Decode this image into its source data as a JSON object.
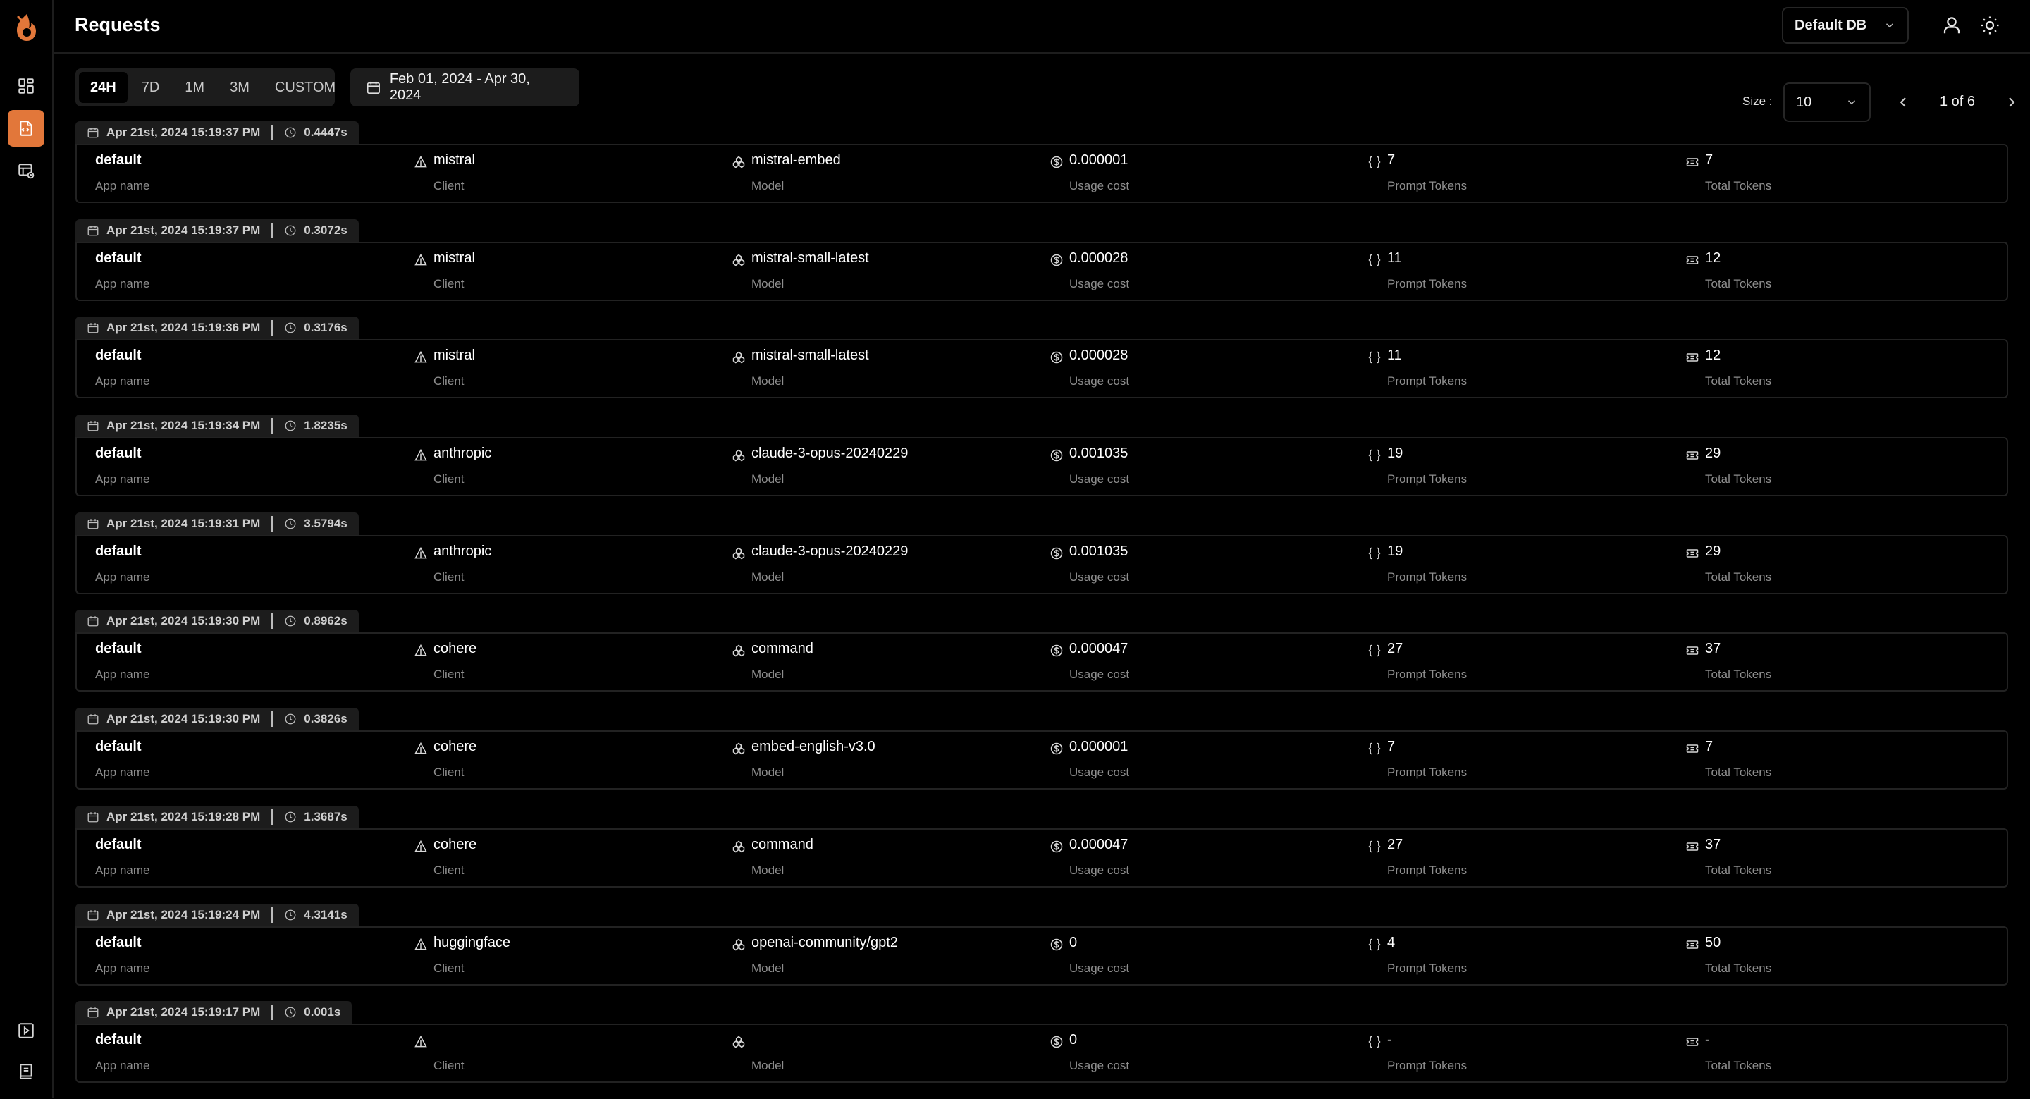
{
  "header": {
    "title": "Requests",
    "db_select": "Default DB"
  },
  "toolbar": {
    "ranges": [
      "24H",
      "7D",
      "1M",
      "3M",
      "CUSTOM"
    ],
    "active_range": "24H",
    "date_range": "Feb 01, 2024 - Apr 30, 2024",
    "size_label": "Size :",
    "size_value": "10",
    "pagination": "1 of 6"
  },
  "labels": {
    "app": "App name",
    "client": "Client",
    "model": "Model",
    "cost": "Usage cost",
    "prompt": "Prompt Tokens",
    "total": "Total Tokens"
  },
  "requests": [
    {
      "time": "Apr 21st, 2024 15:19:37 PM",
      "latency": "0.4447s",
      "app": "default",
      "client": "mistral",
      "model": "mistral-embed",
      "cost": "0.000001",
      "prompt": "7",
      "total": "7"
    },
    {
      "time": "Apr 21st, 2024 15:19:37 PM",
      "latency": "0.3072s",
      "app": "default",
      "client": "mistral",
      "model": "mistral-small-latest",
      "cost": "0.000028",
      "prompt": "11",
      "total": "12"
    },
    {
      "time": "Apr 21st, 2024 15:19:36 PM",
      "latency": "0.3176s",
      "app": "default",
      "client": "mistral",
      "model": "mistral-small-latest",
      "cost": "0.000028",
      "prompt": "11",
      "total": "12"
    },
    {
      "time": "Apr 21st, 2024 15:19:34 PM",
      "latency": "1.8235s",
      "app": "default",
      "client": "anthropic",
      "model": "claude-3-opus-20240229",
      "cost": "0.001035",
      "prompt": "19",
      "total": "29"
    },
    {
      "time": "Apr 21st, 2024 15:19:31 PM",
      "latency": "3.5794s",
      "app": "default",
      "client": "anthropic",
      "model": "claude-3-opus-20240229",
      "cost": "0.001035",
      "prompt": "19",
      "total": "29"
    },
    {
      "time": "Apr 21st, 2024 15:19:30 PM",
      "latency": "0.8962s",
      "app": "default",
      "client": "cohere",
      "model": "command",
      "cost": "0.000047",
      "prompt": "27",
      "total": "37"
    },
    {
      "time": "Apr 21st, 2024 15:19:30 PM",
      "latency": "0.3826s",
      "app": "default",
      "client": "cohere",
      "model": "embed-english-v3.0",
      "cost": "0.000001",
      "prompt": "7",
      "total": "7"
    },
    {
      "time": "Apr 21st, 2024 15:19:28 PM",
      "latency": "1.3687s",
      "app": "default",
      "client": "cohere",
      "model": "command",
      "cost": "0.000047",
      "prompt": "27",
      "total": "37"
    },
    {
      "time": "Apr 21st, 2024 15:19:24 PM",
      "latency": "4.3141s",
      "app": "default",
      "client": "huggingface",
      "model": "openai-community/gpt2",
      "cost": "0",
      "prompt": "4",
      "total": "50"
    },
    {
      "time": "Apr 21st, 2024 15:19:17 PM",
      "latency": "0.001s",
      "app": "default",
      "client": "",
      "model": "",
      "cost": "0",
      "prompt": "-",
      "total": "-"
    }
  ],
  "icons": {
    "sidebar": [
      "dashboard-icon",
      "requests-icon",
      "database-icon",
      "playground-icon",
      "docs-icon"
    ],
    "header": [
      "user-icon",
      "sun-icon"
    ]
  },
  "colors": {
    "accent": "#e2773a",
    "background": "#000000"
  }
}
